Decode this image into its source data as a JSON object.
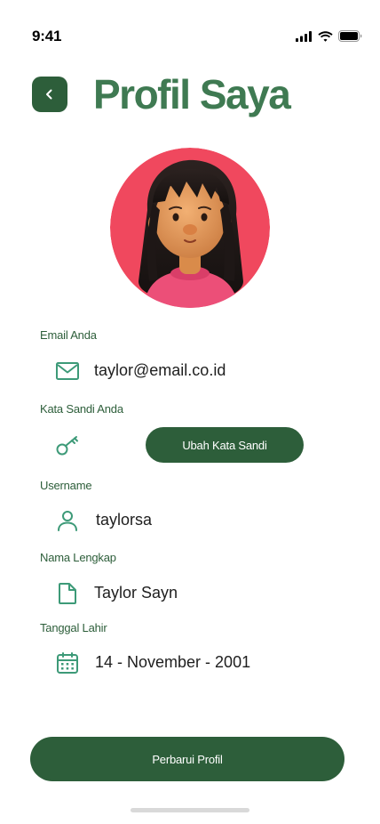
{
  "status_bar": {
    "time": "9:41"
  },
  "header": {
    "title": "Profil Saya"
  },
  "fields": {
    "email": {
      "label": "Email Anda",
      "value": "taylor@email.co.id"
    },
    "password": {
      "label": "Kata Sandi Anda",
      "button_label": "Ubah Kata Sandi"
    },
    "username": {
      "label": "Username",
      "value": "taylorsa"
    },
    "fullname": {
      "label": "Nama Lengkap",
      "value": "Taylor Sayn"
    },
    "birthdate": {
      "label": "Tanggal Lahir",
      "value": "14 - November - 2001"
    }
  },
  "actions": {
    "update_label": "Perbarui Profil"
  },
  "icons": [
    "back-icon",
    "mail-icon",
    "key-icon",
    "user-icon",
    "document-icon",
    "calendar-icon"
  ],
  "colors": {
    "primary": "#2d5e3a",
    "title": "#3f7a52",
    "icon": "#3d9a78",
    "avatar_bg": "#f0485e"
  }
}
